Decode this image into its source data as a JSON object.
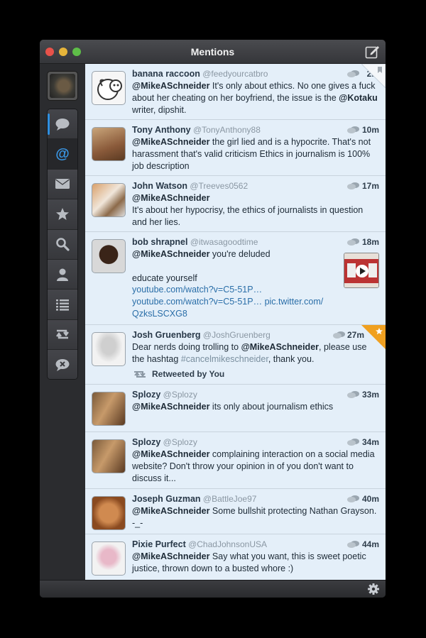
{
  "window": {
    "title": "Mentions"
  },
  "sidebar": {
    "items": [
      {
        "icon": "speech-bubble-icon",
        "name": "timeline"
      },
      {
        "icon": "at-sign-icon",
        "name": "mentions"
      },
      {
        "icon": "envelope-icon",
        "name": "messages"
      },
      {
        "icon": "star-icon",
        "name": "favorites"
      },
      {
        "icon": "search-icon",
        "name": "search"
      },
      {
        "icon": "person-icon",
        "name": "profile"
      },
      {
        "icon": "list-icon",
        "name": "lists"
      },
      {
        "icon": "retweet-icon",
        "name": "retweets"
      },
      {
        "icon": "mute-icon",
        "name": "mute"
      }
    ]
  },
  "tweets": [
    {
      "name": "banana raccoon",
      "handle": "@feedyourcatbro",
      "time": "2m",
      "mention": "@MikeASchneider",
      "text": " It's only about ethics. No one gives a fuck about her cheating on her boyfriend, the issue is the ",
      "mention2": "@Kotaku",
      "text2": " writer, dipshit."
    },
    {
      "name": "Tony Anthony",
      "handle": "@TonyAnthony88",
      "time": "10m",
      "mention": "@MikeASchneider",
      "text": " the girl lied and is a hypocrite. That's not harassment that's valid criticism Ethics in journalism is 100% job description"
    },
    {
      "name": "John Watson",
      "handle": "@Treeves0562",
      "time": "17m",
      "mention": "@MikeASchneider",
      "text": "It's about her hypocrisy, the ethics of journalists in question and her lies."
    },
    {
      "name": "bob shrapnel",
      "handle": "@itwasagoodtime",
      "time": "18m",
      "mention": "@MikeASchneider",
      "text": " you're deluded",
      "line2": "educate yourself",
      "link1": "youtube.com/watch?v=C5-51P…",
      "link2": "youtube.com/watch?v=C5-51P…",
      "link3": "pic.twitter.com/",
      "link4": "QzksLSCXG8"
    },
    {
      "name": "Josh Gruenberg",
      "handle": "@JoshGruenberg",
      "time": "27m",
      "pre": "Dear nerds doing trolling to ",
      "mention": "@MikeASchneider",
      "text": ", please use the hashtag ",
      "hashtag": "#cancelmikeschneider",
      "text2": ", thank you.",
      "retweeted": "Retweeted by You"
    },
    {
      "name": "Splozy",
      "handle": "@Splozy",
      "time": "33m",
      "mention": "@MikeASchneider",
      "text": " its only about journalism ethics"
    },
    {
      "name": "Splozy",
      "handle": "@Splozy",
      "time": "34m",
      "mention": "@MikeASchneider",
      "text": " complaining interaction on a social media website? Don't throw your opinion in of you don't want to discuss it..."
    },
    {
      "name": "Joseph Guzman",
      "handle": "@BattleJoe97",
      "time": "40m",
      "mention": "@MikeASchneider",
      "text": " Some bullshit protecting Nathan Grayson. -_-"
    },
    {
      "name": "Pixie Purfect",
      "handle": "@ChadJohnsonUSA",
      "time": "44m",
      "mention": "@MikeASchneider",
      "text": " Say what you want, this is sweet poetic justice, thrown down to a busted whore :)"
    }
  ],
  "colors": {
    "accent": "#2e8fe0",
    "favorite": "#f0a020",
    "timeline_bg": "#e4eff9"
  }
}
